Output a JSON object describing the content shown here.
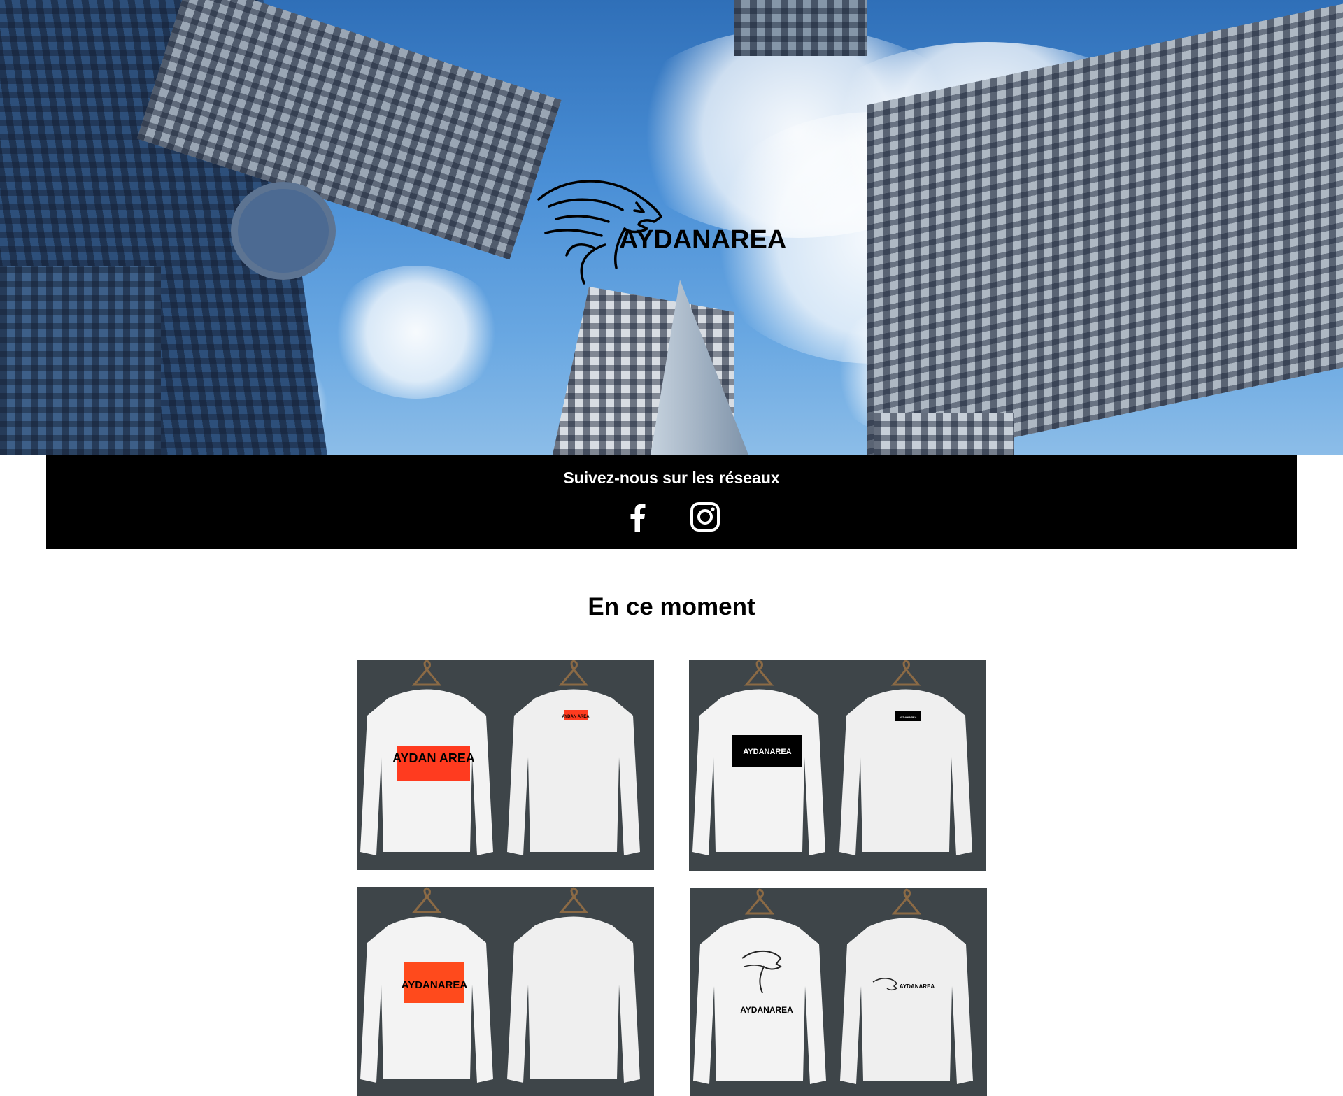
{
  "brand": {
    "logo_text": "AYDANAREA"
  },
  "social": {
    "title": "Suivez-nous sur les réseaux",
    "icons": [
      "facebook-icon",
      "instagram-icon"
    ]
  },
  "section": {
    "title": "En ce moment"
  },
  "products": [
    {
      "front_print": "AYDAN AREA",
      "back_print": "AYDAN AREA",
      "print_color": "#ff3b1f",
      "print_text_color": "#000000"
    },
    {
      "front_print": "AYDANAREA",
      "back_print": "AYDANAREA",
      "print_color": "#000000",
      "print_text_color": "#ffffff"
    },
    {
      "front_print": "AYDANAREA",
      "back_print": "",
      "print_color": "#ff4a1c",
      "print_text_color": "#000000"
    },
    {
      "front_print": "AYDANAREA",
      "back_print": "AYDANAREA",
      "print_color": "none",
      "print_text_color": "#000000"
    }
  ],
  "colors": {
    "bar": "#000000",
    "product_bg": "#3e4549",
    "sky": "#4a8fd6"
  }
}
